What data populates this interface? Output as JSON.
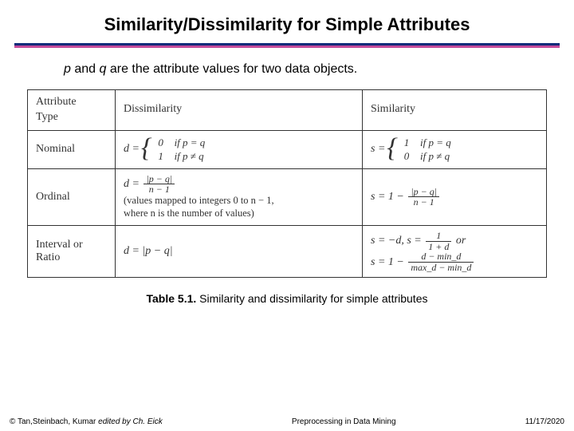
{
  "title": "Similarity/Dissimilarity for Simple Attributes",
  "intro": {
    "p": "p",
    "and": " and ",
    "q": "q",
    "rest": " are the attribute values for two data objects."
  },
  "table": {
    "headers": {
      "type": "Attribute\nType",
      "dissim": "Dissimilarity",
      "sim": "Similarity"
    },
    "rows": [
      {
        "type": "Nominal",
        "dissim": {
          "lhs": "d = ",
          "cases": [
            {
              "val": "0",
              "cond": "if p = q"
            },
            {
              "val": "1",
              "cond": "if p ≠ q"
            }
          ]
        },
        "sim": {
          "lhs": "s = ",
          "cases": [
            {
              "val": "1",
              "cond": "if p = q"
            },
            {
              "val": "0",
              "cond": "if p ≠ q"
            }
          ]
        }
      },
      {
        "type": "Ordinal",
        "dissim": {
          "lhs": "d = ",
          "frac": {
            "num": "|p − q|",
            "den": "n − 1"
          },
          "note1": "(values mapped to integers 0 to n − 1,",
          "note2": "where n is the number of values)"
        },
        "sim": {
          "lhs": "s = 1 − ",
          "frac": {
            "num": "|p − q|",
            "den": "n − 1"
          }
        }
      },
      {
        "type": "Interval or Ratio",
        "dissim": {
          "text": "d = |p − q|"
        },
        "sim": {
          "part1_lhs": "s = −d, s = ",
          "frac1": {
            "num": "1",
            "den": "1 + d"
          },
          "part1_tail": " or",
          "part2_lhs": "s = 1 − ",
          "frac2": {
            "num": "d − min_d",
            "den": "max_d − min_d"
          }
        }
      }
    ]
  },
  "caption": {
    "lead": "Table 5.1.",
    "text": " Similarity and dissimilarity for simple attributes"
  },
  "footer": {
    "copyright": "© Tan,Steinbach, Kumar ",
    "edited": "edited by Ch. Eick",
    "center": "Preprocessing in Data Mining",
    "date": "11/17/2020"
  },
  "chart_data": {
    "type": "table",
    "title": "Table 5.1. Similarity and dissimilarity for simple attributes",
    "columns": [
      "Attribute Type",
      "Dissimilarity",
      "Similarity"
    ],
    "rows": [
      [
        "Nominal",
        "d = 0 if p = q; d = 1 if p ≠ q",
        "s = 1 if p = q; s = 0 if p ≠ q"
      ],
      [
        "Ordinal",
        "d = |p − q| / (n − 1)  (values mapped to integers 0 to n − 1, where n is the number of values)",
        "s = 1 − |p − q| / (n − 1)"
      ],
      [
        "Interval or Ratio",
        "d = |p − q|",
        "s = −d, s = 1 / (1 + d) or s = 1 − (d − min_d) / (max_d − min_d)"
      ]
    ]
  }
}
